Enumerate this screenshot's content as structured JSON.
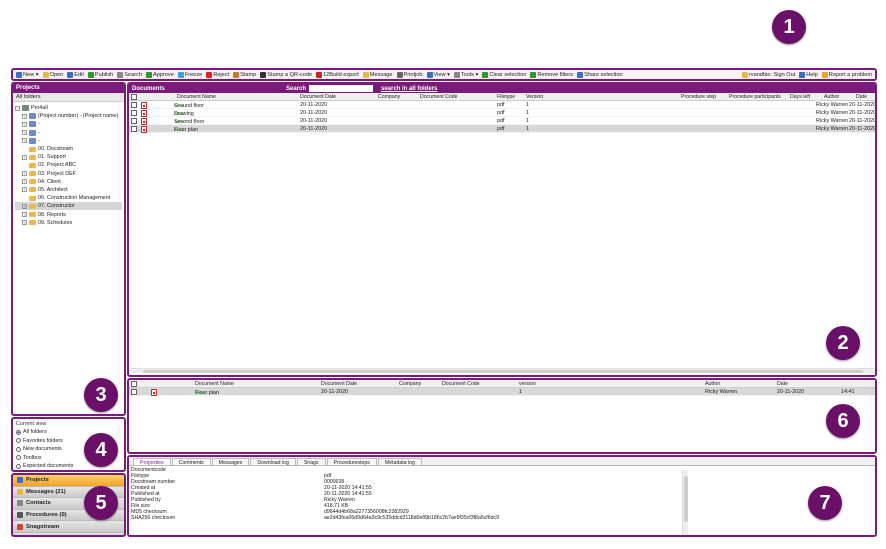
{
  "toolbar": {
    "items": [
      {
        "label": "New ▾",
        "icon": "new-icon",
        "color": "#3a6fc8"
      },
      {
        "label": "Open",
        "icon": "open-icon",
        "color": "#e8b84a"
      },
      {
        "label": "Edit",
        "icon": "edit-icon",
        "color": "#3a6fc8"
      },
      {
        "label": "Publish",
        "icon": "publish-icon",
        "color": "#2a9a2a"
      },
      {
        "label": "Search",
        "icon": "search-icon",
        "color": "#888"
      },
      {
        "label": "Approve",
        "icon": "approve-icon",
        "color": "#2a9a2a"
      },
      {
        "label": "Freeze",
        "icon": "freeze-icon",
        "color": "#3aa0e0"
      },
      {
        "label": "Reject",
        "icon": "reject-icon",
        "color": "#d22"
      },
      {
        "label": "Stamp",
        "icon": "stamp-icon",
        "color": "#c87a2a"
      },
      {
        "label": "Stamp a QR-code",
        "icon": "qr-icon",
        "color": "#333"
      },
      {
        "label": "12Build export",
        "icon": "export-icon",
        "color": "#c22"
      },
      {
        "label": "Message",
        "icon": "message-icon",
        "color": "#e8b84a"
      },
      {
        "label": "Printjob",
        "icon": "print-icon",
        "color": "#666"
      },
      {
        "label": "View ▾",
        "icon": "view-icon",
        "color": "#3a6fc8"
      },
      {
        "label": "Tools ▾",
        "icon": "tools-icon",
        "color": "#888"
      },
      {
        "label": "Clear selection",
        "icon": "clear-selection-icon",
        "color": "#2a9a2a"
      },
      {
        "label": "Remove filters",
        "icon": "remove-filters-icon",
        "color": "#2a9a2a"
      },
      {
        "label": "Share selection",
        "icon": "share-icon",
        "color": "#3a6fc8"
      }
    ],
    "right_items": [
      {
        "label": "rvandtke: Sign Out",
        "icon": "key-icon",
        "color": "#e8b84a"
      },
      {
        "label": "Help",
        "icon": "help-icon",
        "color": "#3a6fc8"
      },
      {
        "label": "Report a problem",
        "icon": "warning-icon",
        "color": "#e8a82a"
      }
    ]
  },
  "projects": {
    "header": "Projects",
    "subheader": "All folders",
    "tree": [
      {
        "label": "Pro4all",
        "indent": 0,
        "pm": "−",
        "kind": "root"
      },
      {
        "label": "(Project number) - (Project name)",
        "indent": 1,
        "pm": "+",
        "kind": "grid"
      },
      {
        "label": "-",
        "indent": 1,
        "pm": "+",
        "kind": "grid"
      },
      {
        "label": "-",
        "indent": 1,
        "pm": "+",
        "kind": "grid"
      },
      {
        "label": "-",
        "indent": 1,
        "pm": "+",
        "kind": "grid"
      },
      {
        "label": "00. Docstream",
        "indent": 1,
        "pm": "",
        "kind": "folder"
      },
      {
        "label": "01. Support",
        "indent": 1,
        "pm": "+",
        "kind": "folder"
      },
      {
        "label": "02. Project ABC",
        "indent": 1,
        "pm": "",
        "kind": "folder"
      },
      {
        "label": "03. Project DEF",
        "indent": 1,
        "pm": "+",
        "kind": "folder"
      },
      {
        "label": "04. Client",
        "indent": 1,
        "pm": "+",
        "kind": "folder"
      },
      {
        "label": "05. Architect",
        "indent": 1,
        "pm": "+",
        "kind": "folder"
      },
      {
        "label": "06. Construction Management",
        "indent": 1,
        "pm": "",
        "kind": "folder"
      },
      {
        "label": "07. Constructor",
        "indent": 1,
        "pm": "+",
        "kind": "folder",
        "selected": true
      },
      {
        "label": "08. Reports",
        "indent": 1,
        "pm": "+",
        "kind": "folder"
      },
      {
        "label": "09. Schedules",
        "indent": 1,
        "pm": "+",
        "kind": "folder"
      }
    ]
  },
  "current_view": {
    "title": "Current view",
    "options": [
      {
        "label": "All folders",
        "checked": true
      },
      {
        "label": "Favorites folders",
        "checked": false
      },
      {
        "label": "New documents",
        "checked": false
      },
      {
        "label": "Toolbox",
        "checked": false
      },
      {
        "label": "Expected documents",
        "checked": false
      }
    ]
  },
  "nav": [
    {
      "label": "Projects",
      "icon": "projects-icon",
      "color": "#3a6fc8",
      "active": true
    },
    {
      "label": "Messages (21)",
      "icon": "messages-icon",
      "color": "#e8b84a",
      "active": false
    },
    {
      "label": "Contacts",
      "icon": "contacts-icon",
      "color": "#888",
      "active": false
    },
    {
      "label": "Procedures (0)",
      "icon": "procedures-icon",
      "color": "#555",
      "active": false
    },
    {
      "label": "Snagstream",
      "icon": "snagstream-icon",
      "color": "#d2442a",
      "active": false
    }
  ],
  "documents": {
    "header": "Documents",
    "search_label": "Search",
    "search_value": "",
    "search_all": "search in all folders",
    "columns": [
      "Document Name",
      "Document Date",
      "Company",
      "Document Code",
      "Filetype",
      "Version",
      "Procedure step",
      "Procedure participants",
      "Days left",
      "Author",
      "Date"
    ],
    "rows": [
      {
        "name": "Ground floor",
        "tag": "New",
        "date": "20-11-2020",
        "company": "",
        "code": "",
        "filetype": "pdf",
        "version": "1",
        "author": "Ricky Warren",
        "date2": "20-11-2020"
      },
      {
        "name": "Drawing",
        "tag": "New",
        "date": "20-11-2020",
        "company": "",
        "code": "",
        "filetype": "pdf",
        "version": "1",
        "author": "Ricky Warren",
        "date2": "20-11-2020"
      },
      {
        "name": "Second floor",
        "tag": "New",
        "date": "20-11-2020",
        "company": "",
        "code": "",
        "filetype": "pdf",
        "version": "1",
        "author": "Ricky Warren",
        "date2": "20-11-2020"
      },
      {
        "name": "Floor plan",
        "tag": "New",
        "date": "20-11-2020",
        "company": "",
        "code": "",
        "filetype": "pdf",
        "version": "1",
        "author": "Ricky Warren",
        "date2": "20-11-2020",
        "selected": true
      }
    ]
  },
  "versions": {
    "columns": [
      "Document Name",
      "Document Date",
      "Company",
      "Document Code",
      "version",
      "Author",
      "Date"
    ],
    "rows": [
      {
        "name": "Floor plan",
        "tag": "New",
        "date": "20-11-2020",
        "version": "1",
        "author": "Ricky Warren",
        "date2": "20-11-2020",
        "time": "14:41"
      }
    ]
  },
  "properties": {
    "tabs": [
      "Properties",
      "Comments",
      "Messages",
      "Download log",
      "Snags",
      "Proceduresteps",
      "Metadata log"
    ],
    "active_tab": "Properties",
    "rows": [
      {
        "key": "Documentcode",
        "value": ""
      },
      {
        "key": "Filetype",
        "value": "pdf"
      },
      {
        "key": "Docstream number",
        "value": "0000638"
      },
      {
        "key": "Created at",
        "value": "20-11-2020 14:41:55"
      },
      {
        "key": "Published at",
        "value": "20-11-2020 14:41:55"
      },
      {
        "key": "Published by",
        "value": "Ricky Warren"
      },
      {
        "key": "File size",
        "value": "418.71 KB"
      },
      {
        "key": "MD5 checksum",
        "value": "d9644d4b68a2277356008fc2382929"
      },
      {
        "key": "SHA256 checksum",
        "value": "ae2d43fea06d9d64a3c9c535ddcd3118d0e89b186c2b7ae9f35cf3f8a5cf6dc9"
      }
    ]
  },
  "badges": [
    "1",
    "2",
    "3",
    "4",
    "5",
    "6",
    "7"
  ],
  "colors": {
    "accent": "#7a1a7a",
    "badge": "#6a1068",
    "new_tag": "#2a9a2a",
    "pdf": "#cc2222"
  }
}
